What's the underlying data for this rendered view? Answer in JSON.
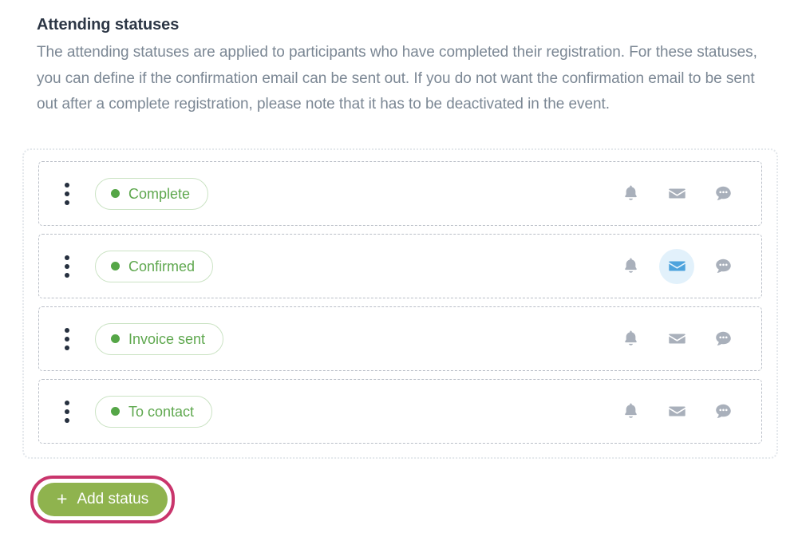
{
  "section": {
    "title": "Attending statuses",
    "description": "The attending statuses are applied to participants who have completed their registration. For these statuses, you can define if the confirmation email can be sent out. If you do not want the confirmation email to be sent out after a complete registration, please note that it has to be deactivated in the event."
  },
  "colors": {
    "heading_text": "#2c3645",
    "body_text": "#7b8794",
    "pill_text": "#5fa84f",
    "pill_dot": "#55a647",
    "pill_border": "#cbe3c4",
    "icon_default": "#a9b0bb",
    "icon_active": "#4da3dd",
    "icon_active_bg": "#e2f1fb",
    "button_green": "#8fb34e",
    "focus_ring_pink": "#c9356c",
    "container_border": "#e4e8ec",
    "row_border": "#b9bec7"
  },
  "statuses": [
    {
      "label": "Complete",
      "dot_color": "#55a647",
      "drag_handle": "drag-dots-icon",
      "actions": [
        {
          "icon": "bell-icon",
          "label": "Notification",
          "active": false
        },
        {
          "icon": "envelope-icon",
          "label": "Email",
          "active": false
        },
        {
          "icon": "speech-bubble-icon",
          "label": "SMS",
          "active": false
        }
      ]
    },
    {
      "label": "Confirmed",
      "dot_color": "#55a647",
      "drag_handle": "drag-dots-icon",
      "actions": [
        {
          "icon": "bell-icon",
          "label": "Notification",
          "active": false
        },
        {
          "icon": "envelope-icon",
          "label": "Email",
          "active": true
        },
        {
          "icon": "speech-bubble-icon",
          "label": "SMS",
          "active": false
        }
      ]
    },
    {
      "label": "Invoice sent",
      "dot_color": "#55a647",
      "drag_handle": "drag-dots-icon",
      "actions": [
        {
          "icon": "bell-icon",
          "label": "Notification",
          "active": false
        },
        {
          "icon": "envelope-icon",
          "label": "Email",
          "active": false
        },
        {
          "icon": "speech-bubble-icon",
          "label": "SMS",
          "active": false
        }
      ]
    },
    {
      "label": "To contact",
      "dot_color": "#55a647",
      "drag_handle": "drag-dots-icon",
      "actions": [
        {
          "icon": "bell-icon",
          "label": "Notification",
          "active": false
        },
        {
          "icon": "envelope-icon",
          "label": "Email",
          "active": false
        },
        {
          "icon": "speech-bubble-icon",
          "label": "SMS",
          "active": false
        }
      ]
    }
  ],
  "add_button": {
    "label": "Add status",
    "plus_glyph": "+",
    "focused": true
  }
}
